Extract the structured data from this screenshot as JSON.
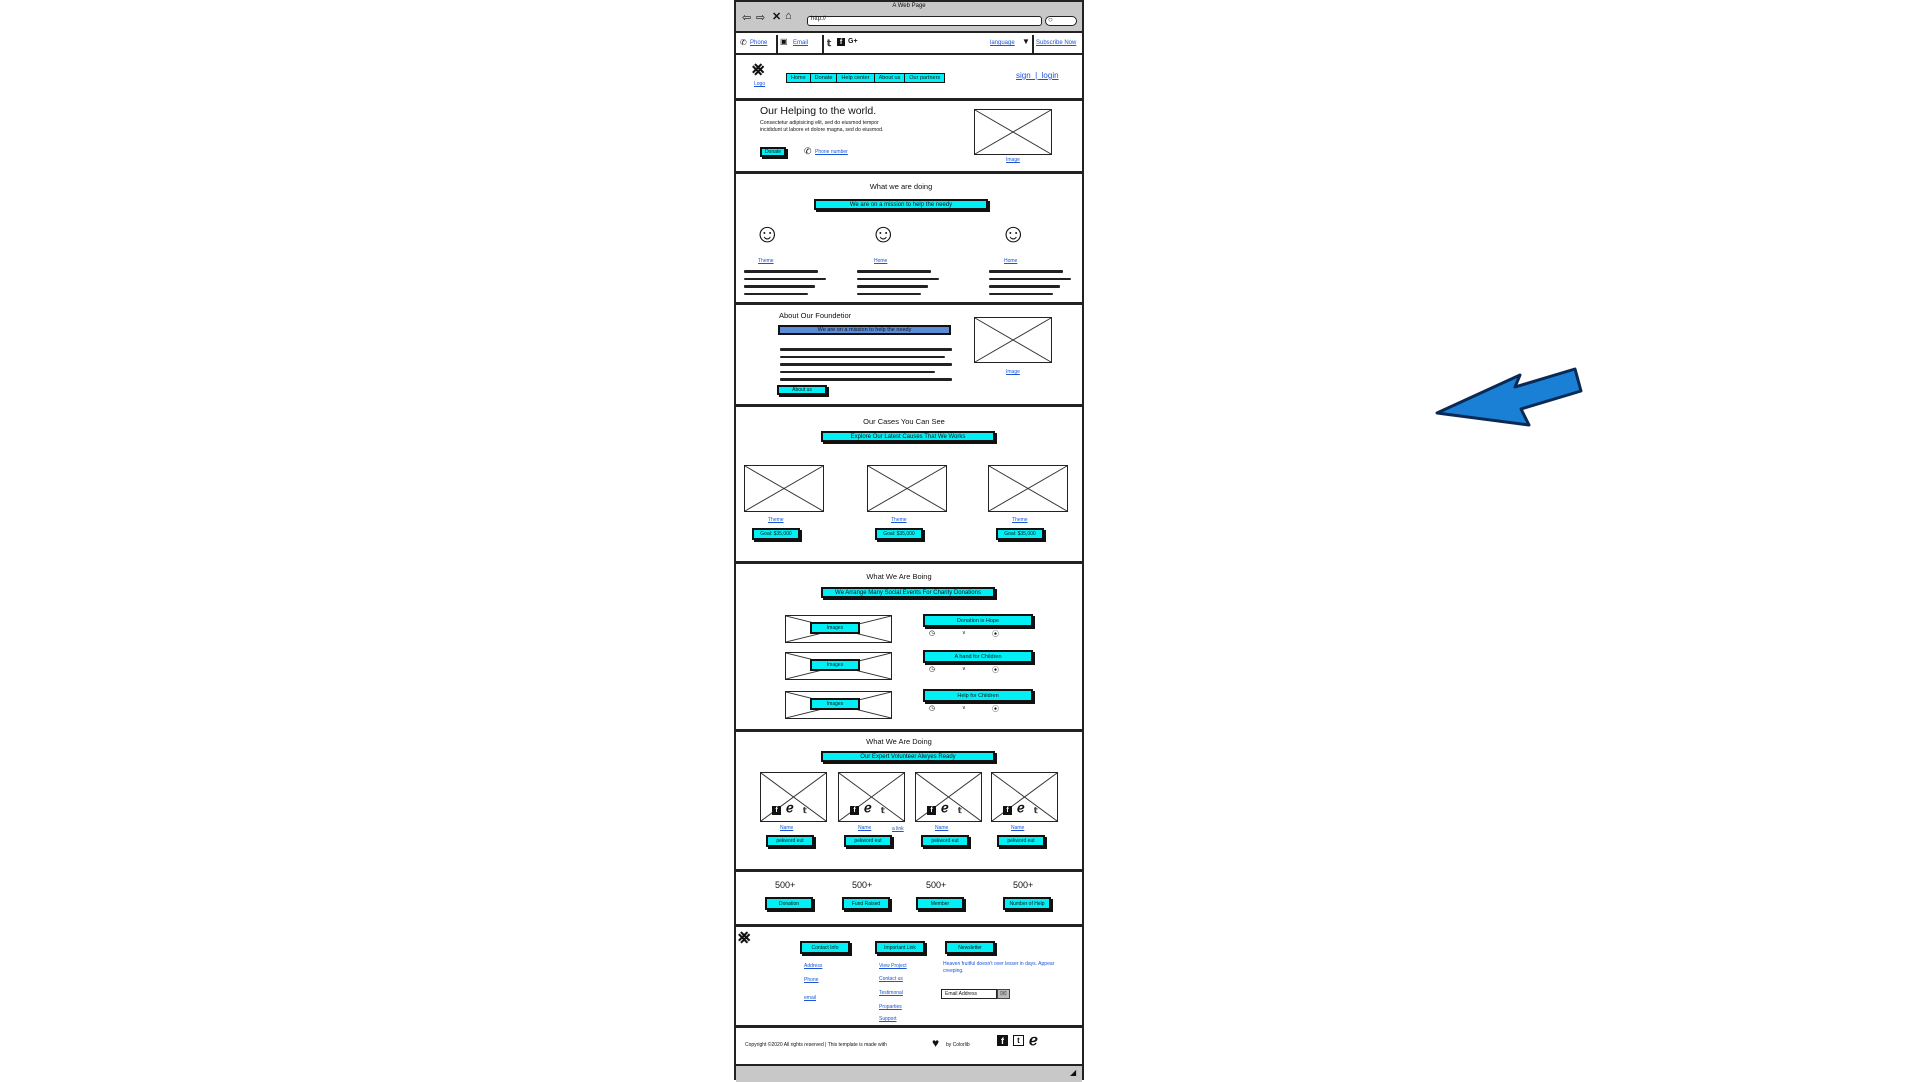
{
  "browser": {
    "title": "A Web Page",
    "url": "http://"
  },
  "topbar": {
    "phone": "Phone",
    "email": "Email",
    "language": "language",
    "subscribe": "Subscribe Now"
  },
  "header": {
    "logo_label": "Logo",
    "nav": [
      "Home",
      "Donate",
      "Help center",
      "About us",
      "Our partners"
    ],
    "auth": "sign  |  login"
  },
  "hero": {
    "title": "Our Helping to the world.",
    "text": "Consectetur adipisicing elit, sed do eiusmod tempor incididunt ut labore et dolore magna, sed do eiusmod.",
    "donate": "Donate",
    "phone": "Phone number",
    "image_label": "Image"
  },
  "doing": {
    "title": "What we are doing",
    "banner": "We are on a mission to help the needy",
    "items": [
      {
        "label": "Theme"
      },
      {
        "label": "Home"
      },
      {
        "label": "Home"
      }
    ]
  },
  "founder": {
    "title": "About Our Foundetior",
    "banner": "We are on a mission to help the needy",
    "button": "About us",
    "image_label": "Image"
  },
  "causes": {
    "title": "Our Cases You Can See",
    "banner": "Explore Our Latest Causes That We Works",
    "items": [
      {
        "label": "Theme",
        "goal": "Goal: $35,000"
      },
      {
        "label": "Theme",
        "goal": "Goal: $35,000"
      },
      {
        "label": "Theme",
        "goal": "Goal: $35,000"
      }
    ]
  },
  "events": {
    "title": "What We Are Boing",
    "banner": "We Arrange Many Social Events For Charity Donations",
    "images": [
      "Images",
      "Images",
      "Images"
    ],
    "list": [
      "Donation is Hope",
      "A hand for Children",
      "Help for Children"
    ]
  },
  "volunteers": {
    "title": "What We Are Doing",
    "banner": "Our Expert Volunteer Alwyes Ready",
    "members": [
      {
        "name": "Name",
        "role": "pekword eut"
      },
      {
        "name": "Name",
        "role": "pekword eut"
      },
      {
        "name": "Name",
        "role": "pekword eut"
      },
      {
        "name": "Name",
        "role": "pekword eut"
      }
    ],
    "extra_link": "a link"
  },
  "stats": [
    {
      "value": "500+",
      "label": "Donation"
    },
    {
      "value": "500+",
      "label": "Fund Raised"
    },
    {
      "value": "500+",
      "label": "Member"
    },
    {
      "value": "500+",
      "label": "Number of Help"
    }
  ],
  "footer": {
    "columns": [
      {
        "heading": "Contact Info",
        "links": [
          "Address",
          "Phone",
          "email"
        ]
      },
      {
        "heading": "Important Link",
        "links": [
          "View Project",
          "Contact us",
          "Testimonal",
          "Proparties",
          "Support"
        ]
      },
      {
        "heading": "Newsletter",
        "links": []
      }
    ],
    "newsletter_text": "Heaven fruitful doesn't over lesser in days. Appear creeping.",
    "email_placeholder": "Email Address",
    "copyright_a": "Copyright ©2020 All rights reserved | This template is  made with",
    "copyright_b": "by Colorlib"
  },
  "colors": {
    "accent": "#00f0f6",
    "link": "#1a55d6",
    "banner_alt": "#5b8ad6",
    "arrow": "#1a80d6"
  }
}
